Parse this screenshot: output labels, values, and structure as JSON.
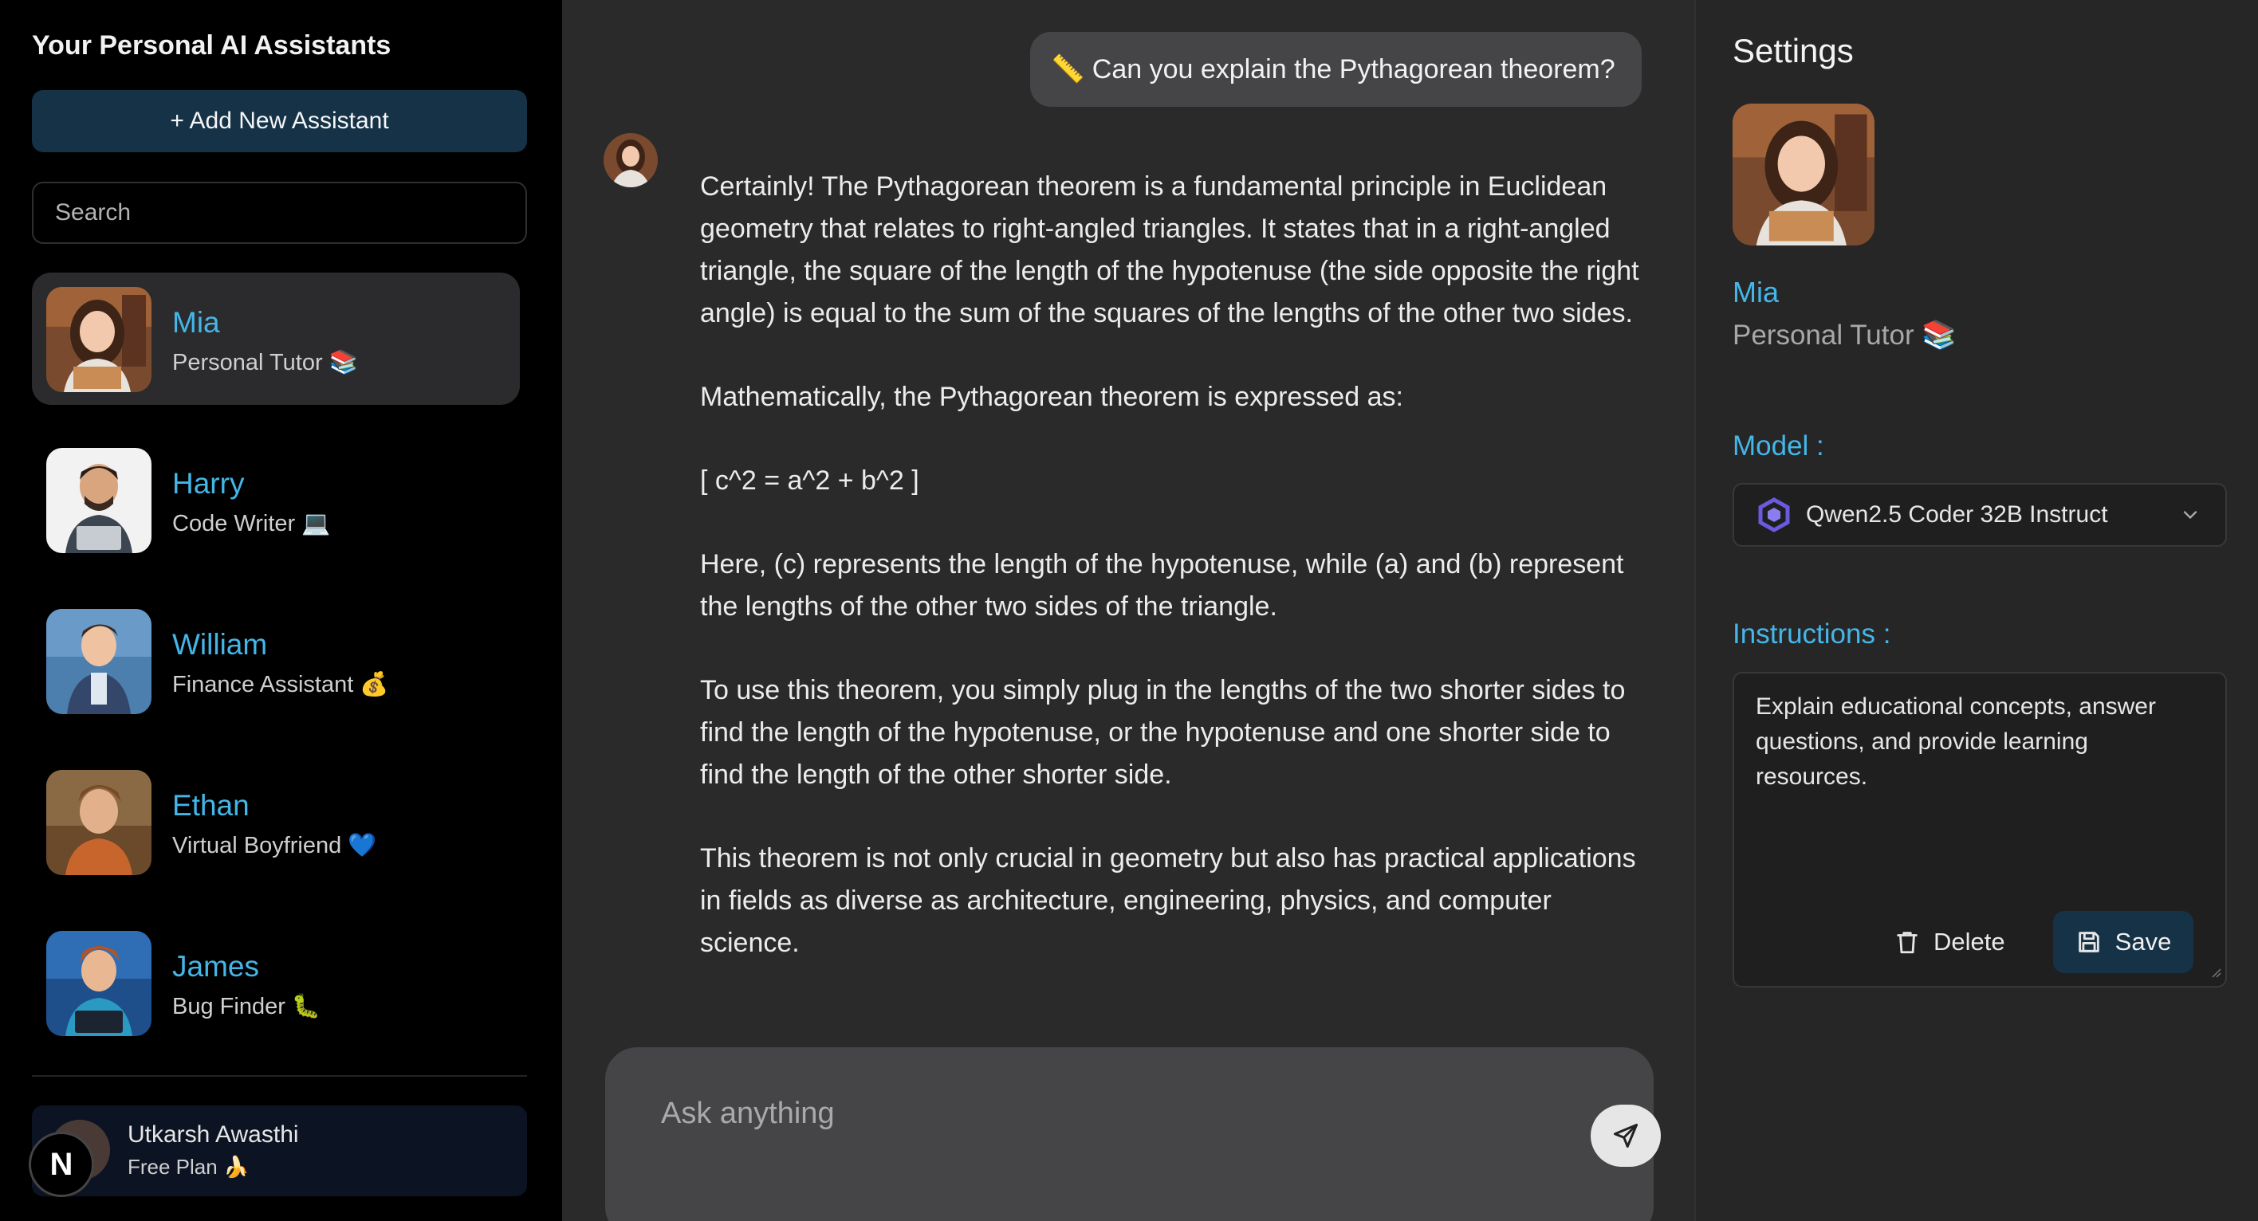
{
  "sidebar": {
    "title": "Your Personal AI Assistants",
    "add_button": "+ Add New Assistant",
    "search_placeholder": "Search",
    "assistants": [
      {
        "name": "Mia",
        "role": "Personal Tutor 📚",
        "active": true
      },
      {
        "name": "Harry",
        "role": "Code Writer 💻",
        "active": false
      },
      {
        "name": "William",
        "role": "Finance Assistant 💰",
        "active": false
      },
      {
        "name": "Ethan",
        "role": "Virtual Boyfriend 💙",
        "active": false
      },
      {
        "name": "James",
        "role": "Bug Finder 🐛",
        "active": false
      }
    ],
    "user": {
      "name": "Utkarsh Awasthi",
      "plan": "Free Plan 🍌",
      "badge": "N"
    }
  },
  "chat": {
    "user_message": "📏 Can you explain the Pythagorean theorem?",
    "assistant_paragraphs": [
      "Certainly! The Pythagorean theorem is a fundamental principle in Euclidean geometry that relates to right-angled triangles. It states that in a right-angled triangle, the square of the length of the hypotenuse (the side opposite the right angle) is equal to the sum of the squares of the lengths of the other two sides.",
      "Mathematically, the Pythagorean theorem is expressed as:",
      "[ c^2 = a^2 + b^2 ]",
      "Here, (c) represents the length of the hypotenuse, while (a) and (b) represent the lengths of the other two sides of the triangle.",
      "To use this theorem, you simply plug in the lengths of the two shorter sides to find the length of the hypotenuse, or the hypotenuse and one shorter side to find the length of the other shorter side.",
      "This theorem is not only crucial in geometry but also has practical applications in fields as diverse as architecture, engineering, physics, and computer science."
    ],
    "input_placeholder": "Ask anything"
  },
  "settings": {
    "title": "Settings",
    "name": "Mia",
    "role": "Personal Tutor 📚",
    "model_label": "Model :",
    "model_value": "Qwen2.5 Coder 32B Instruct",
    "instructions_label": "Instructions :",
    "instructions_value": "Explain educational concepts, answer questions, and provide learning resources.",
    "delete_label": "Delete",
    "save_label": "Save"
  },
  "colors": {
    "accent": "#44b6e8",
    "button_bg": "#163246",
    "sidebar_bg": "#000000",
    "chat_bg": "#2a2a2b"
  },
  "icons": [
    "send-icon",
    "trash-icon",
    "save-icon",
    "chevron-down-icon",
    "qwen-logo-icon"
  ]
}
